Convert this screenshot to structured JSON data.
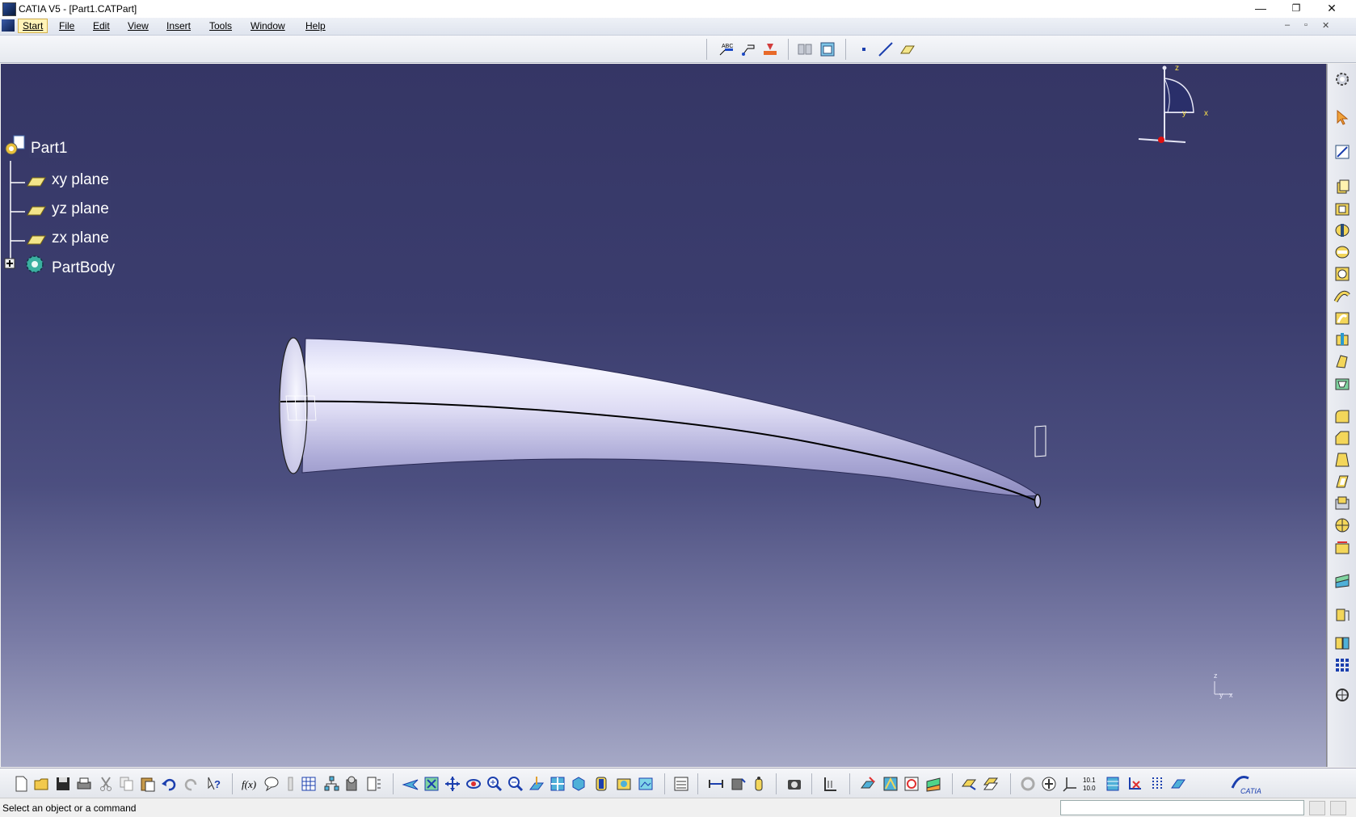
{
  "window": {
    "title": "CATIA V5 - [Part1.CATPart]",
    "minimize": "—",
    "restore": "❐",
    "close": "✕"
  },
  "menu": {
    "items": [
      "Start",
      "File",
      "Edit",
      "View",
      "Insert",
      "Tools",
      "Window",
      "Help"
    ],
    "mdi_min": "–",
    "mdi_restore": "▫",
    "mdi_close": "✕"
  },
  "tree": {
    "root": "Part1",
    "children": [
      "xy plane",
      "yz plane",
      "zx plane",
      "PartBody"
    ]
  },
  "compass": {
    "z": "z",
    "x": "x",
    "y": "y"
  },
  "mini_axis": {
    "z": "z",
    "y": "y",
    "x": "x"
  },
  "status": {
    "message": "Select an object or a command",
    "command_value": ""
  },
  "colors": {
    "viewport_top": "#353665",
    "viewport_bottom": "#a6a9c6",
    "part_surface": "#c9c8ea"
  },
  "icons": {
    "top_toolbar": [
      "text-with-leader-icon",
      "flag-note-icon",
      "measure-point-icon",
      "hide-show-icon",
      "swap-visible-space-icon",
      "point-icon",
      "line-icon",
      "plane-icon"
    ],
    "right_toolbar": [
      "compass-settings-icon",
      "select-arrow-icon",
      "sketcher-icon",
      "pad-icon",
      "pocket-icon",
      "shaft-icon",
      "groove-icon",
      "hole-icon",
      "rib-icon",
      "slot-icon",
      "stiffener-icon",
      "multi-section-solid-icon",
      "removed-multi-section-icon",
      "edge-fillet-icon",
      "chamfer-icon",
      "draft-icon",
      "shell-icon",
      "thickness-icon",
      "thread-icon",
      "remove-face-icon",
      "split-icon",
      "thick-surface-icon",
      "translation-icon",
      "mirror-icon",
      "pattern-icon",
      "scaling-icon"
    ],
    "bottom_toolbar": [
      "new-icon",
      "open-icon",
      "save-icon",
      "print-icon",
      "cut-icon",
      "copy-icon",
      "paste-icon",
      "undo-icon",
      "redo-icon",
      "whats-this-icon",
      "formula-icon",
      "knowledge-icon",
      "rule-icon",
      "table-icon",
      "parameters-icon",
      "parts-tree-icon",
      "design-table-icon",
      "fly-mode-icon",
      "fit-all-icon",
      "pan-icon",
      "rotate-icon",
      "zoom-in-icon",
      "zoom-out-icon",
      "normal-view-icon",
      "multi-view-icon",
      "iso-view-icon",
      "shading-icon",
      "render-style-icon",
      "save-view-icon",
      "analysis-icon",
      "reference-elements-icon",
      "axis-system-icon",
      "measure-between-icon",
      "measure-item-icon",
      "measure-inertia-icon",
      "capture-icon",
      "constraint-icon",
      "apply-material-icon",
      "surface-draft-analysis-icon",
      "curvature-analysis-icon",
      "hide-icon",
      "swap-icon",
      "update-icon",
      "catalog-browser-icon",
      "anchor-icon",
      "axis-icon",
      "scale-icon",
      "snap-icon",
      "show-icon",
      "grid-icon",
      "publish-icon",
      "catia-logo-icon"
    ]
  }
}
